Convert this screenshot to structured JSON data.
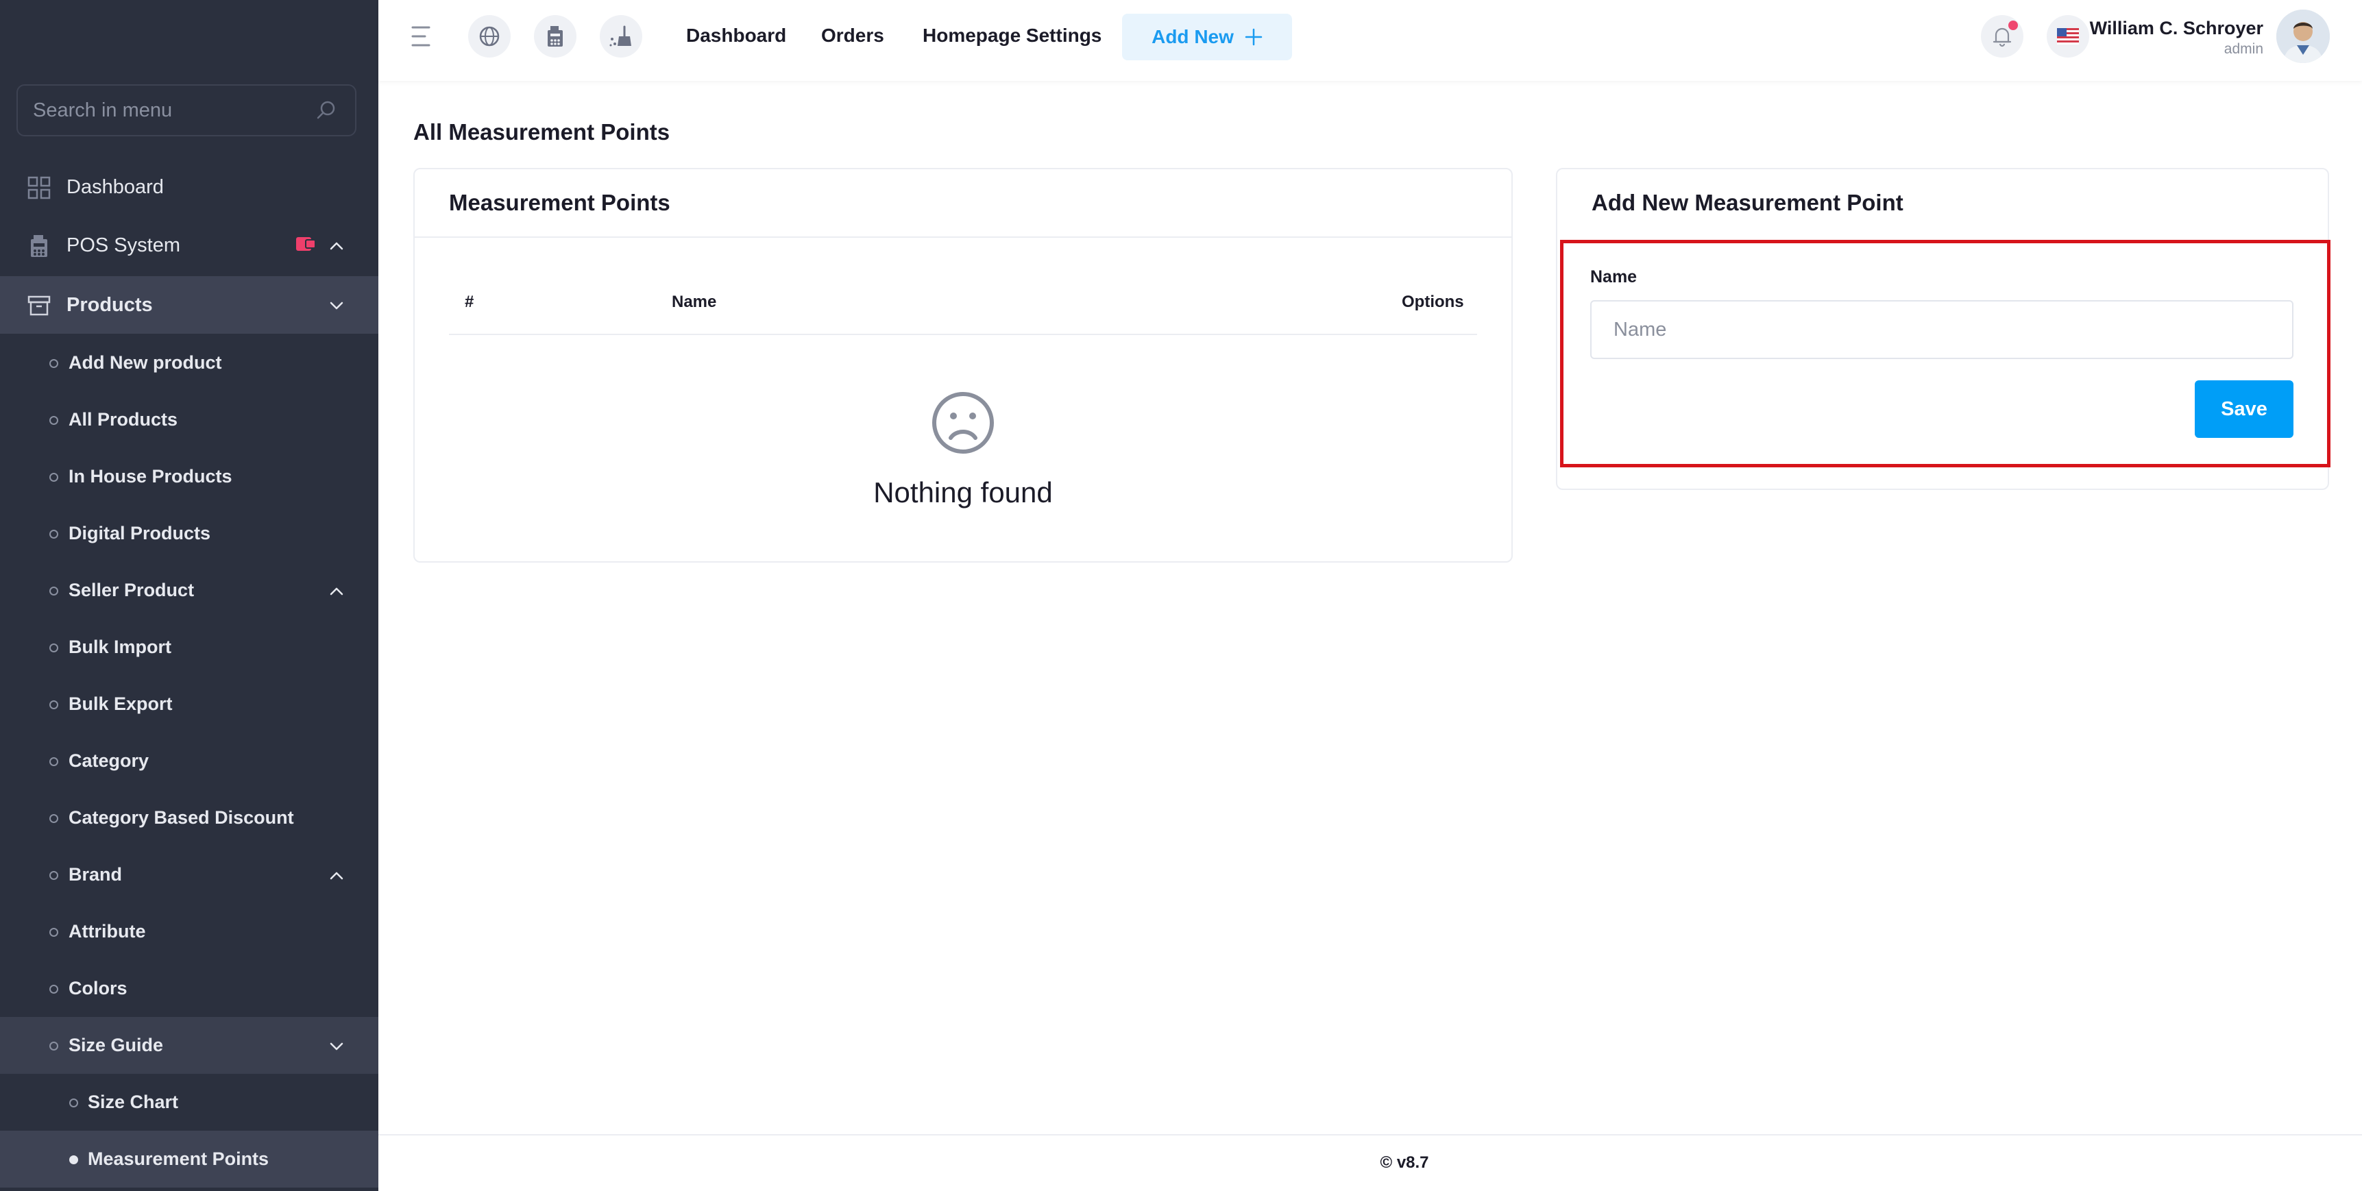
{
  "sidebar": {
    "search_placeholder": "Search in menu",
    "items": [
      {
        "label": "Dashboard",
        "icon": "grid-icon"
      },
      {
        "label": "POS System",
        "icon": "calculator-icon",
        "badge_icon": "sale-tag-icon"
      },
      {
        "label": "Products",
        "icon": "box-icon"
      }
    ],
    "product_subitems": [
      {
        "label": "Add New product"
      },
      {
        "label": "All Products"
      },
      {
        "label": "In House Products"
      },
      {
        "label": "Digital Products"
      },
      {
        "label": "Seller Product"
      },
      {
        "label": "Bulk Import"
      },
      {
        "label": "Bulk Export"
      },
      {
        "label": "Category"
      },
      {
        "label": "Category Based Discount"
      },
      {
        "label": "Brand"
      },
      {
        "label": "Attribute"
      },
      {
        "label": "Colors"
      },
      {
        "label": "Size Guide"
      }
    ],
    "size_guide_subitems": [
      {
        "label": "Size Chart"
      },
      {
        "label": "Measurement Points"
      }
    ]
  },
  "topbar": {
    "links": [
      "Dashboard",
      "Orders",
      "Homepage Settings"
    ],
    "add_new_label": "Add New",
    "user_name": "William C. Schroyer",
    "user_role": "admin"
  },
  "main": {
    "page_title": "All Measurement Points",
    "list_card": {
      "title": "Measurement Points",
      "columns": [
        "#",
        "Name",
        "Options"
      ],
      "empty_text": "Nothing found"
    },
    "form_card": {
      "title": "Add New Measurement Point",
      "name_label": "Name",
      "name_placeholder": "Name",
      "save_label": "Save"
    }
  },
  "footer": {
    "text": "© v8.7"
  },
  "colors": {
    "sidebar_bg": "#2b303e",
    "accent": "#009ef7",
    "highlight": "#d7141b"
  }
}
